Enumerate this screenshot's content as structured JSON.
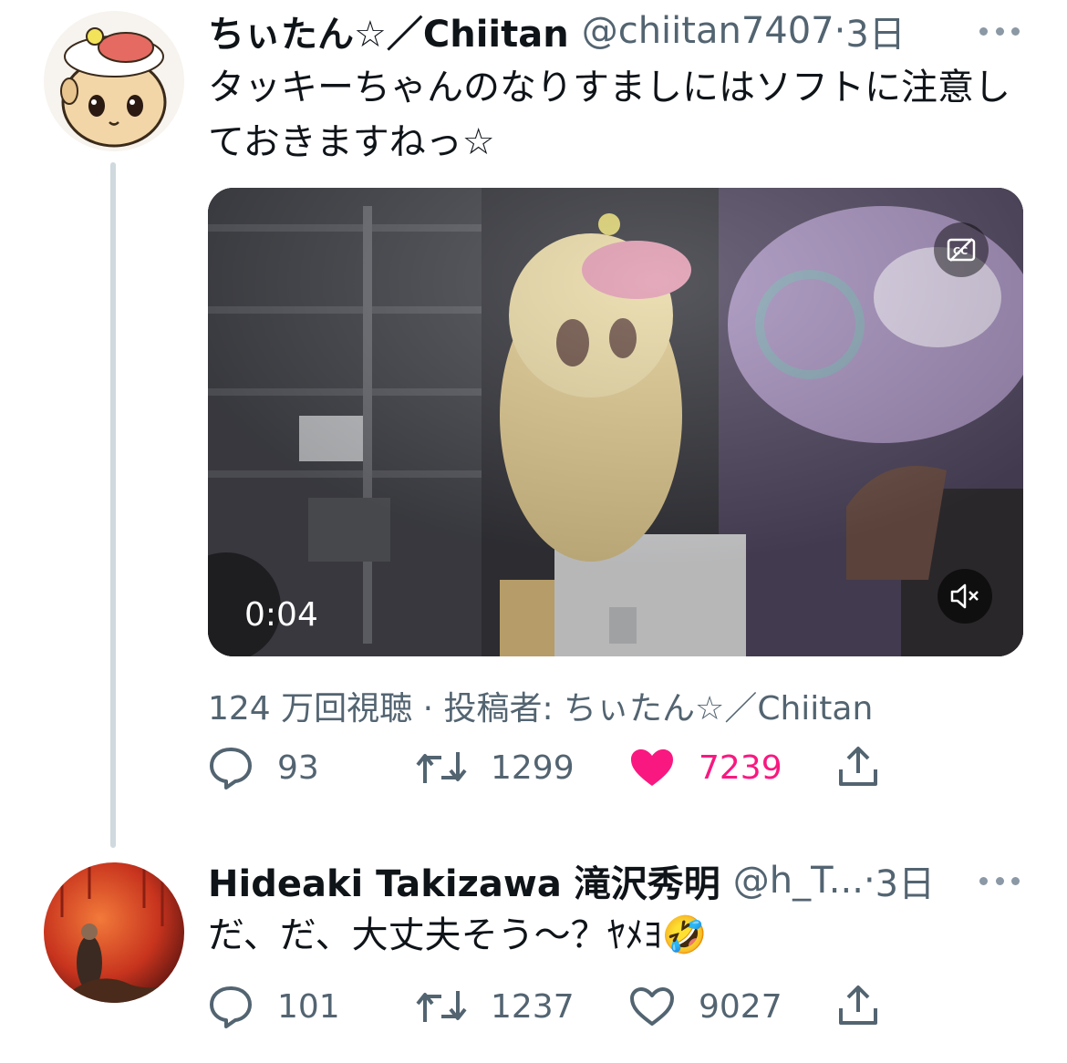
{
  "tweets": [
    {
      "name": "ちぃたん☆／Chiitan",
      "handle": "@chiitan7407",
      "dot": "·",
      "time": "3日",
      "text": "タッキーちゃんのなりすましにはソフトに注意しておきますねっ☆",
      "media": {
        "duration": "0:04",
        "views_line": "124 万回視聴 · 投稿者: ちぃたん☆／Chiitan"
      },
      "replies": "93",
      "retweets": "1299",
      "likes": "7239",
      "liked": true
    },
    {
      "name": "Hideaki Takizawa 滝沢秀明",
      "handle": "@h_T...",
      "dot": "·",
      "time": "3日",
      "text": "だ、だ、大丈夫そう〜？ﾔﾒﾖ🤣",
      "replies": "101",
      "retweets": "1237",
      "likes": "9027",
      "liked": false
    }
  ],
  "icons": {
    "reply": "reply-icon",
    "retweet": "retweet-icon",
    "like": "heart-icon",
    "share": "share-icon",
    "more": "more-icon",
    "captions": "captions-icon",
    "mute": "mute-icon"
  },
  "colors": {
    "like": "#f91880",
    "muted": "#536471",
    "text": "#0f1419",
    "thread_line": "#cfd9de"
  }
}
